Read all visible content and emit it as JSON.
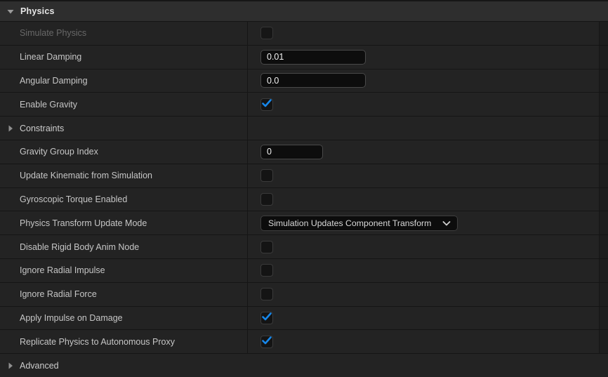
{
  "header": {
    "label": "Physics",
    "expanded": true,
    "icon": "triangle-down-icon"
  },
  "rows": [
    {
      "kind": "property",
      "label": "Simulate Physics",
      "control": "checkbox",
      "checked": false,
      "disabled": true
    },
    {
      "kind": "property",
      "label": "Linear Damping",
      "control": "text",
      "value": "0.01",
      "input_width": "normal"
    },
    {
      "kind": "property",
      "label": "Angular Damping",
      "control": "text",
      "value": "0.0",
      "input_width": "normal"
    },
    {
      "kind": "property",
      "label": "Enable Gravity",
      "control": "checkbox",
      "checked": true
    },
    {
      "kind": "category",
      "label": "Constraints",
      "expanded": false,
      "full_width": false,
      "icon": "triangle-right-icon"
    },
    {
      "kind": "property",
      "label": "Gravity Group Index",
      "control": "text",
      "value": "0",
      "input_width": "narrow"
    },
    {
      "kind": "property",
      "label": "Update Kinematic from Simulation",
      "control": "checkbox",
      "checked": false
    },
    {
      "kind": "property",
      "label": "Gyroscopic Torque Enabled",
      "control": "checkbox",
      "checked": false
    },
    {
      "kind": "property",
      "label": "Physics Transform Update Mode",
      "control": "dropdown",
      "value": "Simulation Updates Component Transform",
      "icon": "chevron-down-icon"
    },
    {
      "kind": "property",
      "label": "Disable Rigid Body Anim Node",
      "control": "checkbox",
      "checked": false
    },
    {
      "kind": "property",
      "label": "Ignore Radial Impulse",
      "control": "checkbox",
      "checked": false
    },
    {
      "kind": "property",
      "label": "Ignore Radial Force",
      "control": "checkbox",
      "checked": false
    },
    {
      "kind": "property",
      "label": "Apply Impulse on Damage",
      "control": "checkbox",
      "checked": true
    },
    {
      "kind": "property",
      "label": "Replicate Physics to Autonomous Proxy",
      "control": "checkbox",
      "checked": true
    },
    {
      "kind": "category",
      "label": "Advanced",
      "expanded": false,
      "full_width": true,
      "icon": "triangle-right-icon"
    }
  ],
  "icons": {
    "check": "checkmark-icon",
    "header_expanded": "triangle-down-icon",
    "category_collapsed": "triangle-right-icon",
    "dropdown": "chevron-down-icon"
  },
  "colors": {
    "accent": "#1787EA"
  }
}
